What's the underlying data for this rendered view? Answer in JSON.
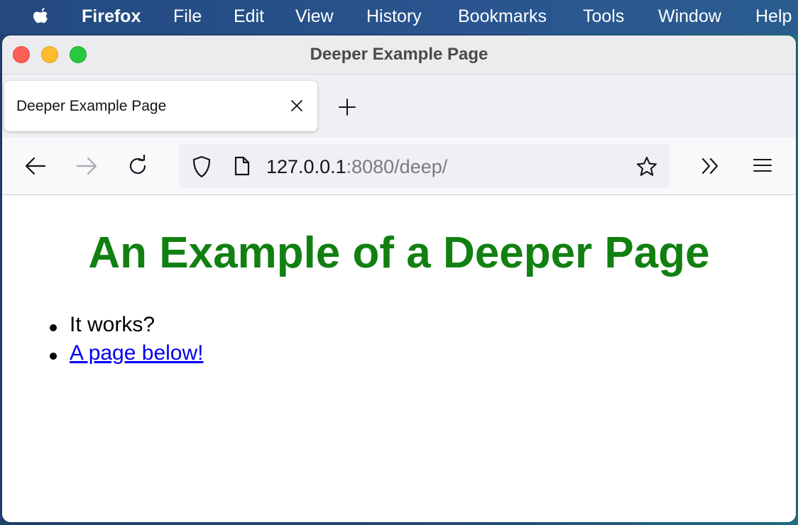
{
  "menubar": {
    "apple_icon": "apple-logo-icon",
    "app_name": "Firefox",
    "items": [
      "File",
      "Edit",
      "View",
      "History",
      "Bookmarks",
      "Tools",
      "Window",
      "Help"
    ]
  },
  "window": {
    "title": "Deeper Example Page",
    "traffic_lights": {
      "close": "#fe5f57",
      "minimize": "#febc2e",
      "zoom": "#28c840"
    }
  },
  "tabs": [
    {
      "title": "Deeper Example Page",
      "active": true
    }
  ],
  "navbar": {
    "back_icon": "arrow-left-icon",
    "forward_icon": "arrow-right-icon",
    "reload_icon": "reload-icon",
    "shield_icon": "shield-icon",
    "page_icon": "page-icon",
    "url_host": "127.0.0.1",
    "url_rest": ":8080/deep/",
    "bookmark_icon": "star-icon",
    "overflow_icon": "chevron-double-right-icon",
    "menu_icon": "hamburger-menu-icon"
  },
  "page": {
    "heading": "An Example of a Deeper Page",
    "heading_color": "#118011",
    "list": [
      {
        "text": "It works?",
        "link": false
      },
      {
        "text": "A page below!",
        "link": true
      }
    ],
    "link_color": "#0000ee"
  }
}
